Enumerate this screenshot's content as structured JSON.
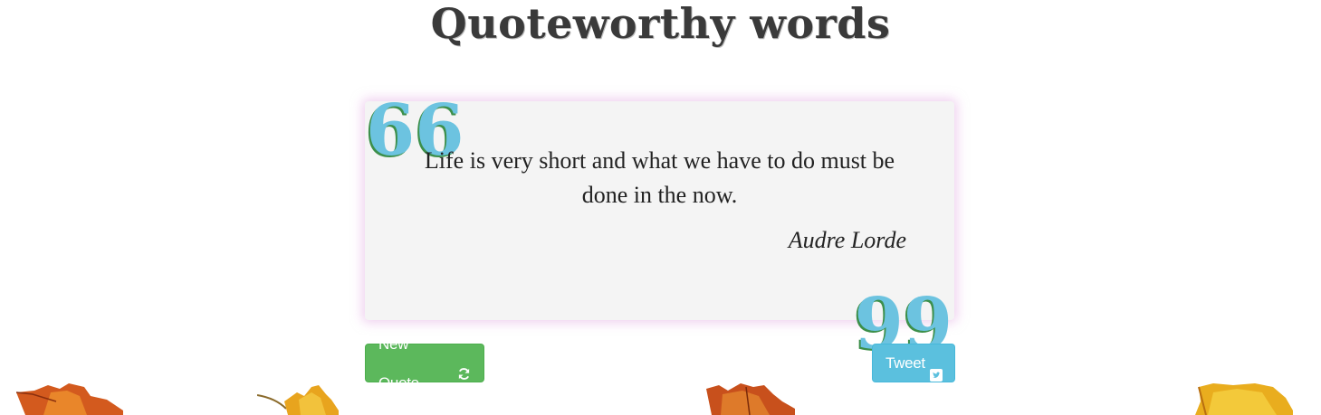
{
  "page": {
    "title": "Quoteworthy words"
  },
  "quote": {
    "text": "Life is very short and what we have to do must be done in the now.",
    "author": "Audre Lorde",
    "open_mark": "66",
    "close_mark": "99"
  },
  "buttons": {
    "new_quote_label": "New Quote",
    "tweet_label": "Tweet"
  },
  "colors": {
    "new_quote_button": "#5cb85c",
    "tweet_button": "#5bc0de",
    "quote_mark": "#6cc3e0",
    "card_background": "#f4f4f4",
    "card_glow": "#e2aae2"
  },
  "icons": {
    "new_quote": "refresh-icon",
    "tweet": "twitter-square-icon",
    "decoration": "autumn-leaf"
  }
}
